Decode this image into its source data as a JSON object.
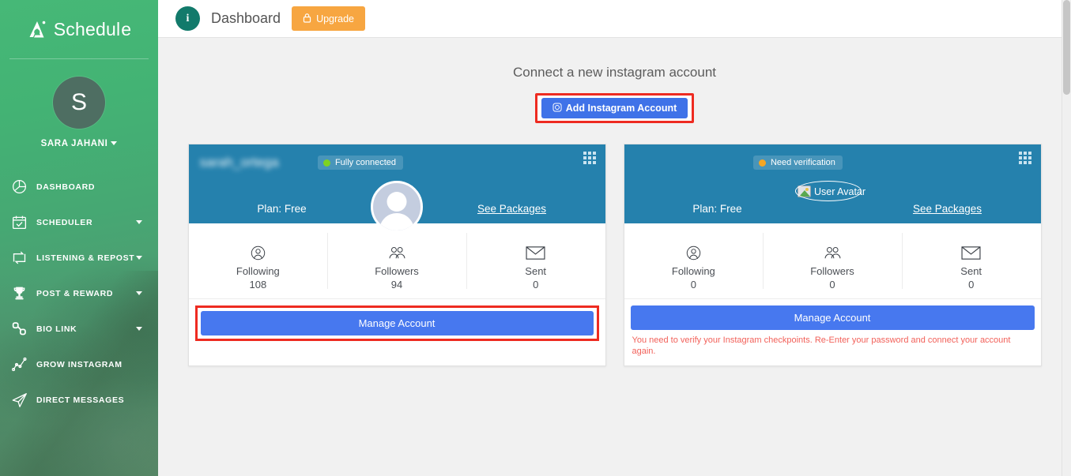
{
  "brand": {
    "name": "Schedul",
    "suffix": "e",
    "mark": "ai-logo-icon"
  },
  "profile": {
    "initial": "S",
    "name": "SARA JAHANI"
  },
  "sidebar": {
    "items": [
      {
        "label": "DASHBOARD",
        "icon": "pie-chart-icon",
        "expandable": false
      },
      {
        "label": "SCHEDULER",
        "icon": "calendar-check-icon",
        "expandable": true
      },
      {
        "label": "LISTENING & REPOST",
        "icon": "repost-loop-icon",
        "expandable": true
      },
      {
        "label": "POST & REWARD",
        "icon": "trophy-icon",
        "expandable": true
      },
      {
        "label": "BIO LINK",
        "icon": "link-chain-icon",
        "expandable": true
      },
      {
        "label": "GROW INSTAGRAM",
        "icon": "growth-graph-icon",
        "expandable": false
      },
      {
        "label": "DIRECT MESSAGES",
        "icon": "paper-plane-icon",
        "expandable": false
      }
    ]
  },
  "topbar": {
    "info_icon": "info-circle-icon",
    "info_letter": "i",
    "title": "Dashboard",
    "upgrade_label": "Upgrade",
    "upgrade_icon": "lock-icon"
  },
  "main": {
    "connect_heading": "Connect a new instagram account",
    "add_button_label": "Add Instagram Account",
    "add_button_icon": "instagram-icon"
  },
  "colors": {
    "sidebar_green": "#46b877",
    "card_header_blue": "#2581ad",
    "primary_blue": "#4778ef",
    "add_blue": "#3f72e8",
    "upgrade_orange": "#f7a641",
    "highlight_red": "#ee2b21",
    "error_red": "#f2615a",
    "connected_green": "#7ed321",
    "verification_orange": "#f5a623",
    "info_teal": "#127a6b"
  },
  "accounts": [
    {
      "username": "sarah_ortega",
      "username_redacted": true,
      "status_label": "Fully connected",
      "status_color": "#7ed321",
      "plan": "Plan: Free",
      "see_packages": "See Packages",
      "avatar_type": "placeholder-avatar",
      "grid_icon": "grid-menu-icon",
      "stats": [
        {
          "label": "Following",
          "value": "108",
          "icon": "single-user-icon"
        },
        {
          "label": "Followers",
          "value": "94",
          "icon": "multiple-users-icon"
        },
        {
          "label": "Sent",
          "value": "0",
          "icon": "envelope-icon"
        }
      ],
      "manage_label": "Manage Account",
      "manage_highlighted": true,
      "error": ""
    },
    {
      "username": "",
      "username_redacted": true,
      "status_label": "Need verification",
      "status_color": "#f5a623",
      "plan": "Plan: Free",
      "see_packages": "See Packages",
      "avatar_type": "broken-image",
      "avatar_alt": "User Avatar",
      "grid_icon": "grid-menu-icon",
      "stats": [
        {
          "label": "Following",
          "value": "0",
          "icon": "single-user-icon"
        },
        {
          "label": "Followers",
          "value": "0",
          "icon": "multiple-users-icon"
        },
        {
          "label": "Sent",
          "value": "0",
          "icon": "envelope-icon"
        }
      ],
      "manage_label": "Manage Account",
      "manage_highlighted": false,
      "error": "You need to verify your Instagram checkpoints. Re-Enter your password and connect your account again."
    }
  ]
}
